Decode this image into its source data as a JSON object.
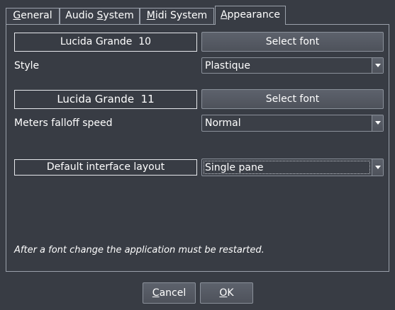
{
  "tabs": [
    {
      "label": "General",
      "mnemonic": "G",
      "rest": "eneral",
      "active": false
    },
    {
      "label": "Audio System",
      "prefix": "Audio ",
      "mnemonic": "S",
      "rest": "ystem",
      "active": false
    },
    {
      "label": "Midi System",
      "mnemonic": "M",
      "rest": "idi System",
      "active": false
    },
    {
      "label": "Appearance",
      "mnemonic": "A",
      "rest": "ppearance",
      "active": true
    }
  ],
  "appearance": {
    "font1": {
      "display": "Lucida Grande  10",
      "button_label": "Select font"
    },
    "style": {
      "label": "Style",
      "value": "Plastique"
    },
    "font2": {
      "display": "Lucida Grande  11",
      "button_label": "Select font"
    },
    "meters": {
      "label": "Meters falloff speed",
      "value": "Normal"
    },
    "layout": {
      "label": "Default interface layout",
      "value": "Single pane"
    },
    "note": "After a font change the application must be restarted."
  },
  "dialog": {
    "cancel": {
      "mnemonic": "C",
      "rest": "ancel"
    },
    "ok": {
      "mnemonic": "O",
      "rest": "K"
    }
  },
  "icons": {
    "dropdown": "chevron-down-icon"
  }
}
